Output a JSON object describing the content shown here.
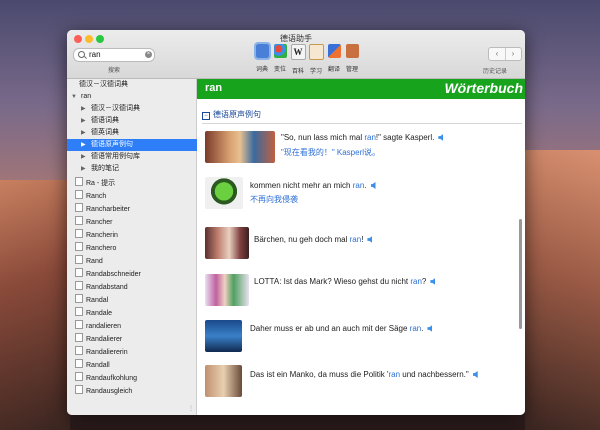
{
  "window": {
    "title": "德语助手"
  },
  "search": {
    "query": "ran",
    "caption": "搜索"
  },
  "toolbar": [
    {
      "label": "词典",
      "icon": "dictionary-icon",
      "color": "#4a7fd8"
    },
    {
      "label": "变位",
      "icon": "conjugation-icon",
      "color": "#e84a3a"
    },
    {
      "label": "百科",
      "icon": "wiki-icon",
      "color": "#f0f0f0"
    },
    {
      "label": "学习",
      "icon": "study-icon",
      "color": "#f0a030"
    },
    {
      "label": "翻译",
      "icon": "translate-icon",
      "color": "#3a6fd8"
    },
    {
      "label": "管理",
      "icon": "manage-icon",
      "color": "#c87040"
    }
  ],
  "history_label": "历史记录",
  "nav": {
    "back": "‹",
    "forward": "›"
  },
  "sidebar": {
    "root": "德汉－汉德词典",
    "group": "ran",
    "children": [
      "德汉－汉德词典",
      "德语词典",
      "德英词典",
      "德语原声例句",
      "德语常用例句库",
      "我的笔记"
    ],
    "selected_index": 3,
    "results": [
      "Ra - 提示",
      "Ranch",
      "Rancharbeiter",
      "Rancher",
      "Rancherin",
      "Ranchero",
      "Rand",
      "Randabschneider",
      "Randabstand",
      "Randal",
      "Randale",
      "randalieren",
      "Randalierer",
      "Randaliererin",
      "Randall",
      "Randaufkohlung",
      "Randausgleich"
    ]
  },
  "content": {
    "word": "ran",
    "brand": "Wörterbuch",
    "section": "德语原声例句",
    "examples": [
      {
        "parts": [
          "\"So, nun lass mich mal ",
          "ran",
          "!\" sagte Kasperl."
        ],
        "translation": "\"现在看我的！\" Kasperl说。"
      },
      {
        "parts": [
          "kommen nicht mehr an mich ",
          "ran",
          "."
        ],
        "translation": "不再向我侵袭"
      },
      {
        "parts": [
          "Bärchen, nu geh doch mal ",
          "ran",
          "!"
        ],
        "translation": ""
      },
      {
        "parts": [
          "LOTTA: Ist das Mark? Wieso gehst du nicht ",
          "ran",
          "?"
        ],
        "translation": ""
      },
      {
        "parts": [
          "Daher muss er ab und an auch mit der Säge ",
          "ran",
          "."
        ],
        "translation": ""
      },
      {
        "parts": [
          "Das ist ein Manko, da muss die Politik '",
          "ran",
          " und nachbessern.\""
        ],
        "translation": ""
      }
    ]
  },
  "colors": {
    "header_green": "#17a31c",
    "selection": "#2d7ef7",
    "link_blue": "#2d6fd6"
  }
}
